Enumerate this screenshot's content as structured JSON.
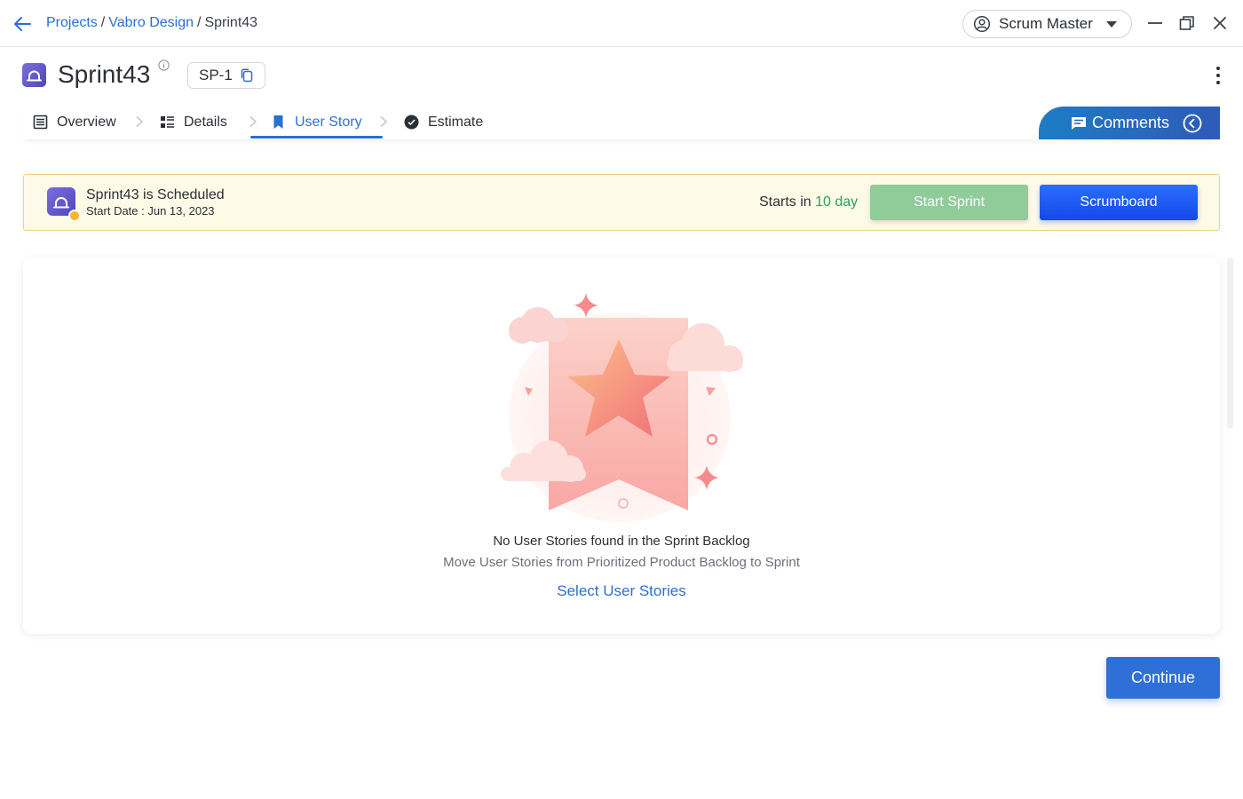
{
  "breadcrumb": {
    "projects": "Projects",
    "project": "Vabro Design",
    "current": "Sprint43",
    "separator": "/"
  },
  "role_selector": {
    "value": "Scrum Master"
  },
  "sprint": {
    "title": "Sprint43",
    "key": "SP-1"
  },
  "tabs": [
    {
      "label": "Overview",
      "icon": "list-icon"
    },
    {
      "label": "Details",
      "icon": "details-icon"
    },
    {
      "label": "User Story",
      "icon": "bookmark-icon",
      "active": true
    },
    {
      "label": "Estimate",
      "icon": "check-circle-icon"
    }
  ],
  "comments_tab": {
    "label": "Comments"
  },
  "status_banner": {
    "title": "Sprint43 is Scheduled",
    "start_date": "Start Date : Jun 13, 2023",
    "starts_in_prefix": "Starts in",
    "starts_in_value": "10 day",
    "start_button": "Start Sprint",
    "scrumboard_button": "Scrumboard"
  },
  "empty_state": {
    "title": "No User Stories found in the Sprint Backlog",
    "subtitle": "Move User Stories from Prioritized Product Backlog to Sprint",
    "action": "Select User Stories"
  },
  "footer": {
    "continue_button": "Continue"
  },
  "colors": {
    "accent": "#2a6fd6",
    "banner_bg": "#fefae8",
    "banner_border": "#ecd27a",
    "start_button": "#8fcc9a",
    "scrumboard_button": "#1449e8",
    "days_text": "#2e9e55"
  }
}
